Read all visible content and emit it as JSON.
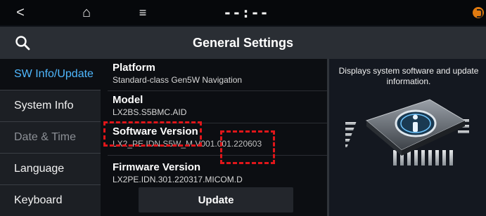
{
  "topbar": {
    "back_icon": "<",
    "home_icon": "⌂",
    "menu_icon": "≡",
    "time": "--:--",
    "notify_color": "#e07a10"
  },
  "header": {
    "title": "General Settings"
  },
  "sidebar": {
    "items": [
      {
        "label": "SW Info/Update",
        "state": "active"
      },
      {
        "label": "System Info",
        "state": "normal"
      },
      {
        "label": "Date & Time",
        "state": "disabled"
      },
      {
        "label": "Language",
        "state": "normal"
      },
      {
        "label": "Keyboard",
        "state": "normal"
      }
    ]
  },
  "main": {
    "rows": [
      {
        "title": "Platform",
        "value": "Standard-class Gen5W Navigation"
      },
      {
        "title": "Model",
        "value": "LX2BS.S5BMC.AID"
      },
      {
        "title": "Software Version",
        "value": "LX2_PE.IDN.S5W_M.V001.001.220603"
      },
      {
        "title": "Firmware Version",
        "value": "LX2PE.IDN.301.220317.MICOM.D"
      }
    ],
    "update_label": "Update"
  },
  "info_panel": {
    "description": "Displays system software and update information."
  },
  "colors": {
    "accent": "#4fb8ff",
    "highlight": "#e0161a"
  }
}
